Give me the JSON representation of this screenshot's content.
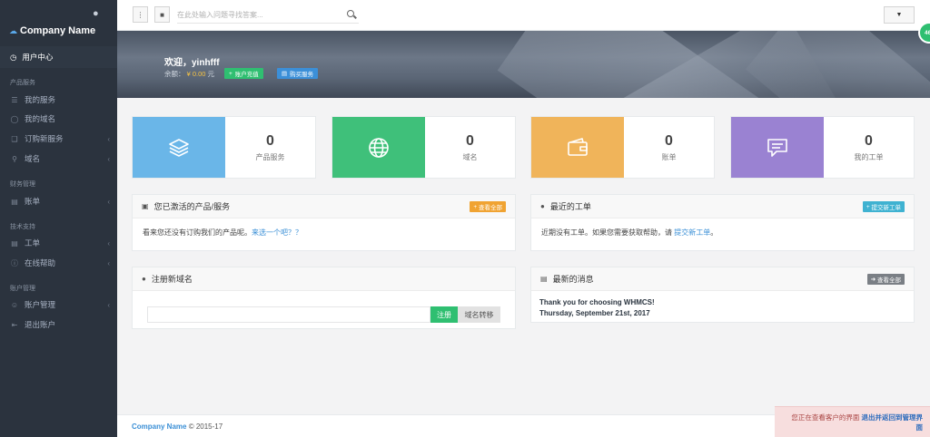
{
  "sidebar": {
    "brand": "Company Name",
    "active_item": "用户中心",
    "sections": [
      {
        "title": "产品服务"
      },
      {
        "title": "财务管理"
      },
      {
        "title": "技术支持"
      },
      {
        "title": "账户管理"
      }
    ],
    "items": [
      {
        "label": "我的服务",
        "icon": "layers-icon"
      },
      {
        "label": "我的域名",
        "icon": "globe-icon"
      },
      {
        "label": "订购新服务",
        "icon": "cart-icon",
        "has_submenu": true
      },
      {
        "label": "域名",
        "icon": "search-icon",
        "has_submenu": true
      },
      {
        "label": "账单",
        "icon": "document-icon",
        "has_submenu": true
      },
      {
        "label": "工单",
        "icon": "ticket-icon",
        "has_submenu": true
      },
      {
        "label": "在线帮助",
        "icon": "help-icon",
        "has_submenu": true
      },
      {
        "label": "账户管理",
        "icon": "user-icon",
        "has_submenu": true
      },
      {
        "label": "退出账户",
        "icon": "logout-icon"
      }
    ]
  },
  "topbar": {
    "search_placeholder": "在此处输入问题寻找答案..."
  },
  "banner": {
    "greeting": "欢迎，yinhfff",
    "balance_label": "余额：",
    "balance_value": "¥ 0.00",
    "balance_unit": "元",
    "btn_recharge": "账户充值",
    "btn_buy": "购买服务",
    "badge": "46"
  },
  "stats": [
    {
      "value": "0",
      "label": "产品服务",
      "color": "#6ab6e8",
      "icon": "layers-icon"
    },
    {
      "value": "0",
      "label": "域名",
      "color": "#3fc07a",
      "icon": "globe-icon"
    },
    {
      "value": "0",
      "label": "账单",
      "color": "#f0b45a",
      "icon": "wallet-icon"
    },
    {
      "value": "0",
      "label": "我的工单",
      "color": "#9a82d2",
      "icon": "comment-icon"
    }
  ],
  "panels": {
    "products": {
      "title": "您已激活的产品/服务",
      "button": "查看全部",
      "empty_text": "看来您还没有订购我们的产品呢。",
      "empty_link": "来选一个吧？？"
    },
    "tickets": {
      "title": "最近的工单",
      "button": "提交新工单",
      "empty_text": "近期没有工单。如果您需要获取帮助，请",
      "empty_link": "提交新工单",
      "empty_end": "。"
    },
    "domain": {
      "title": "注册新域名",
      "register": "注册",
      "transfer": "域名转移"
    },
    "news": {
      "title": "最新的消息",
      "button": "查看全部",
      "headline": "Thank you for choosing WHMCS!",
      "date": "Thursday, September 21st, 2017"
    }
  },
  "footer": {
    "company": "Company Name",
    "copy": "© 2015-17"
  },
  "admin_notice": {
    "text": "您正在查看客户的界面",
    "link": "退出并返回到管理界面"
  },
  "colors": {
    "sidebar_bg": "#2b333e",
    "green": "#2fbf71",
    "orange": "#f0a332",
    "cyan": "#3fb2d1",
    "grey": "#7a7f85",
    "link": "#3a8fd6"
  }
}
